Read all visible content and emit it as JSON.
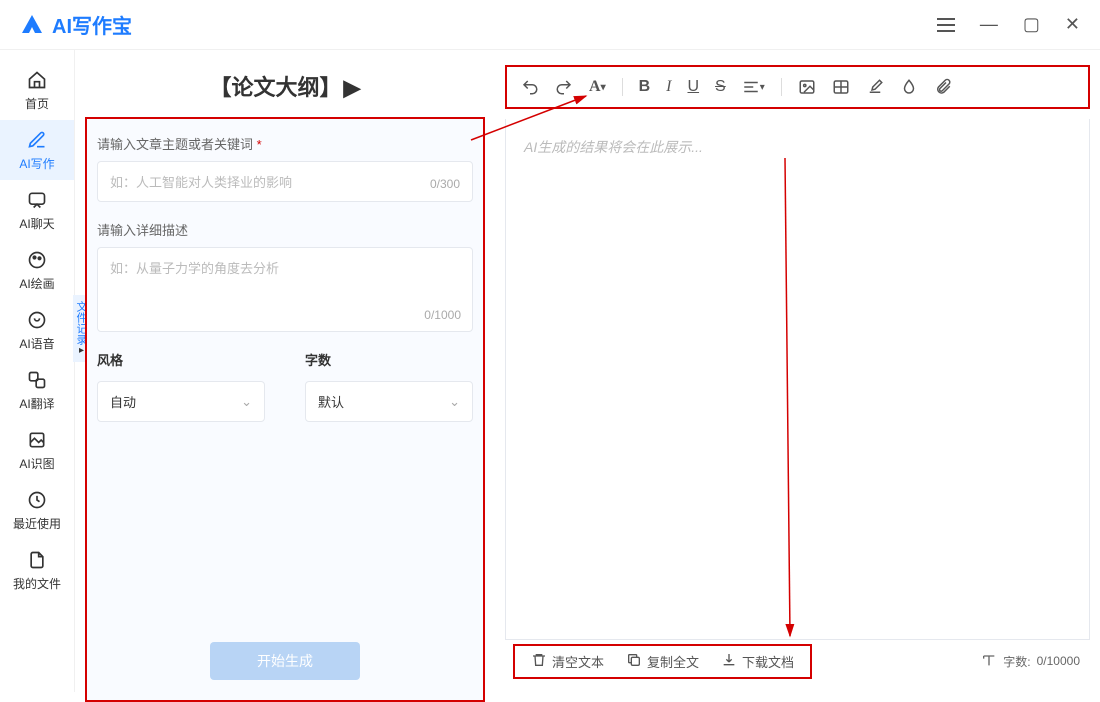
{
  "app": {
    "name": "AI写作宝"
  },
  "sidebar": {
    "items": [
      {
        "label": "首页"
      },
      {
        "label": "AI写作"
      },
      {
        "label": "AI聊天"
      },
      {
        "label": "AI绘画"
      },
      {
        "label": "AI语音"
      },
      {
        "label": "AI翻译"
      },
      {
        "label": "AI识图"
      },
      {
        "label": "最近使用"
      },
      {
        "label": "我的文件"
      }
    ]
  },
  "page": {
    "title": "【论文大纲】"
  },
  "form": {
    "topic_label": "请输入文章主题或者关键词",
    "topic_placeholder": "如：人工智能对人类择业的影响",
    "topic_count": "0/300",
    "desc_label": "请输入详细描述",
    "desc_placeholder": "如：从量子力学的角度去分析",
    "desc_count": "0/1000",
    "style_label": "风格",
    "style_value": "自动",
    "words_label": "字数",
    "words_value": "默认",
    "generate": "开始生成",
    "file_tab": "文件记录"
  },
  "editor": {
    "placeholder": "AI生成的结果将会在此展示..."
  },
  "toolbar": {
    "font_letter": "A"
  },
  "bottom": {
    "clear": "清空文本",
    "copy": "复制全文",
    "download": "下载文档",
    "word_label": "字数:",
    "word_count": "0/10000"
  },
  "colors": {
    "accent": "#1e7cff",
    "highlight": "#d40000"
  }
}
